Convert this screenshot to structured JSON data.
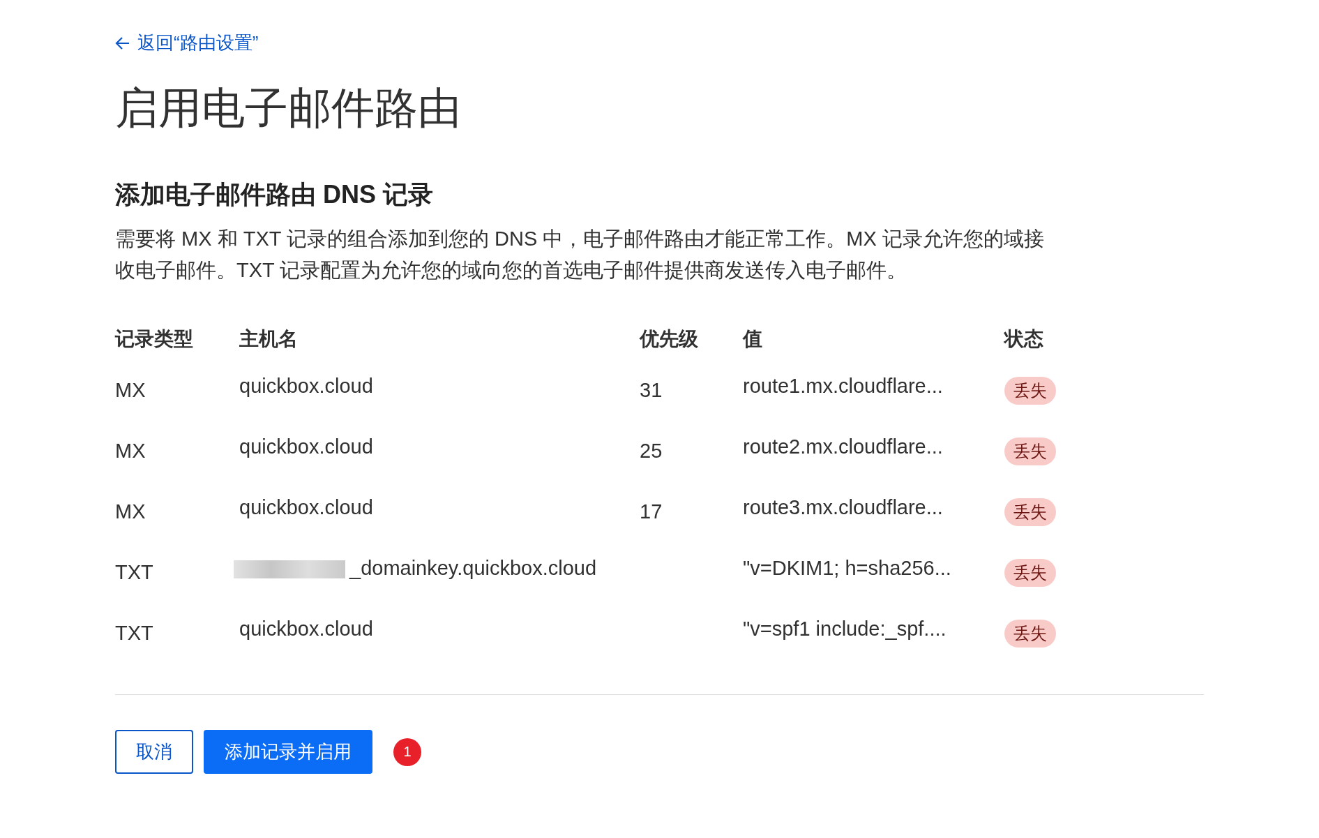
{
  "back_link": {
    "label": "返回“路由设置”"
  },
  "title": "启用电子邮件路由",
  "section": {
    "heading": "添加电子邮件路由 DNS 记录",
    "description": "需要将 MX 和 TXT 记录的组合添加到您的 DNS 中，电子邮件路由才能正常工作。MX 记录允许您的域接收电子邮件。TXT 记录配置为允许您的域向您的首选电子邮件提供商发送传入电子邮件。"
  },
  "table": {
    "columns": [
      "记录类型",
      "主机名",
      "优先级",
      "值",
      "状态"
    ],
    "rows": [
      {
        "type": "MX",
        "hostname": "quickbox.cloud",
        "redacted": false,
        "priority": "31",
        "value": "route1.mx.cloudflare...",
        "status": "丢失"
      },
      {
        "type": "MX",
        "hostname": "quickbox.cloud",
        "redacted": false,
        "priority": "25",
        "value": "route2.mx.cloudflare...",
        "status": "丢失"
      },
      {
        "type": "MX",
        "hostname": "quickbox.cloud",
        "redacted": false,
        "priority": "17",
        "value": "route3.mx.cloudflare...",
        "status": "丢失"
      },
      {
        "type": "TXT",
        "hostname": "_domainkey.quickbox.cloud",
        "redacted": true,
        "value": "\"v=DKIM1; h=sha256...",
        "status": "丢失"
      },
      {
        "type": "TXT",
        "hostname": "quickbox.cloud",
        "redacted": false,
        "value": "\"v=spf1 include:_spf....",
        "status": "丢失"
      }
    ]
  },
  "buttons": [
    {
      "label": "取消",
      "kind": "secondary"
    },
    {
      "label": "添加记录并启用",
      "kind": "primary"
    }
  ],
  "notification_badge": "1"
}
